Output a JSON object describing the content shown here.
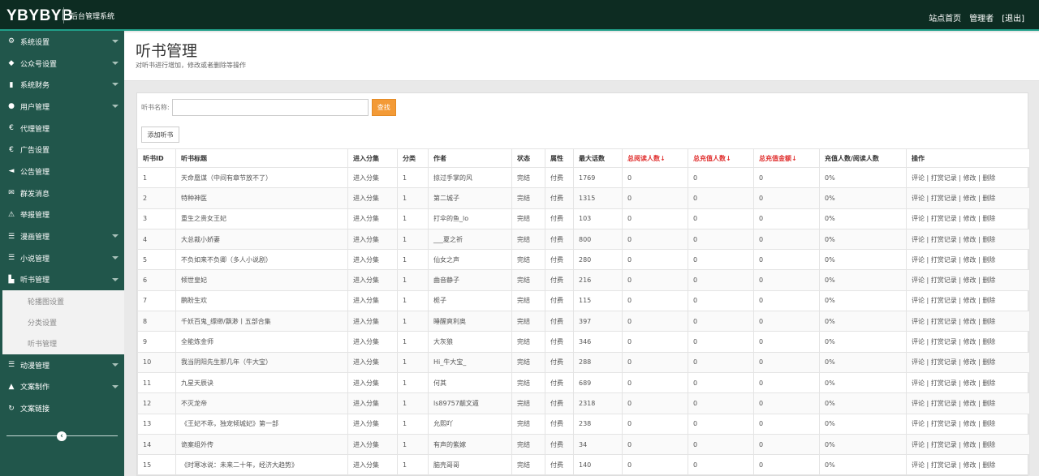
{
  "header": {
    "brand": "YBYBYB",
    "subtitle": "后台管理系统",
    "nav": [
      "站点首页",
      "管理者",
      "[退出]"
    ]
  },
  "sidebar": {
    "items": [
      {
        "icon": "⚙",
        "icon_name": "gear-icon",
        "label": "系统设置",
        "caret": true
      },
      {
        "icon": "◆",
        "icon_name": "tag-icon",
        "label": "公众号设置",
        "caret": true
      },
      {
        "icon": "▮",
        "icon_name": "bar-chart-icon",
        "label": "系统财务",
        "caret": true
      },
      {
        "icon": "●",
        "icon_name": "user-icon",
        "label": "用户管理",
        "caret": true
      },
      {
        "icon": "€",
        "icon_name": "euro-icon",
        "label": "代理管理",
        "caret": false
      },
      {
        "icon": "€",
        "icon_name": "euro-icon",
        "label": "广告设置",
        "caret": false
      },
      {
        "icon": "◄",
        "icon_name": "volume-icon",
        "label": "公告管理",
        "caret": false
      },
      {
        "icon": "✉",
        "icon_name": "envelope-icon",
        "label": "群发消息",
        "caret": false
      },
      {
        "icon": "⚠",
        "icon_name": "warning-icon",
        "label": "举报管理",
        "caret": false
      },
      {
        "icon": "☰",
        "icon_name": "list-icon",
        "label": "漫画管理",
        "caret": true
      },
      {
        "icon": "☰",
        "icon_name": "list-icon",
        "label": "小说管理",
        "caret": true
      },
      {
        "icon": "▙",
        "icon_name": "chart-icon",
        "label": "听书管理",
        "caret": true
      }
    ],
    "subitems": [
      "轮播图设置",
      "分类设置",
      "听书管理"
    ],
    "items_after": [
      {
        "icon": "☰",
        "icon_name": "list-icon",
        "label": "动漫管理",
        "caret": true
      },
      {
        "icon": "▲",
        "icon_name": "user-edit-icon",
        "label": "文案制作",
        "caret": true
      },
      {
        "icon": "↻",
        "icon_name": "link-icon",
        "label": "文案链接",
        "caret": false
      }
    ]
  },
  "page": {
    "title": "听书管理",
    "description": "对听书进行增加，修改或者删除等操作"
  },
  "search": {
    "label": "听书名称:",
    "placeholder": "",
    "button": "查找"
  },
  "add_button": "添加听书",
  "table": {
    "headers": [
      "听书ID",
      "听书标题",
      "进入分集",
      "分类",
      "作者",
      "状态",
      "属性",
      "最大话数",
      "总阅读人数↓",
      "总充值人数↓",
      "总充值金额↓",
      "充值人数/阅读人数",
      "操作"
    ],
    "red_headers": [
      8,
      9,
      10
    ],
    "ops": [
      "评论",
      "打赏记录",
      "修改",
      "删除"
    ],
    "rows": [
      [
        "1",
        "天命凰谋（中间有章节放不了）",
        "进入分集",
        "1",
        "掠过手掌的风",
        "完结",
        "付费",
        "1769",
        "0",
        "0",
        "0",
        "0%"
      ],
      [
        "2",
        "特种神医",
        "进入分集",
        "1",
        "第二城子",
        "完结",
        "付费",
        "1315",
        "0",
        "0",
        "0",
        "0%"
      ],
      [
        "3",
        "重生之贵女王妃",
        "进入分集",
        "1",
        "打伞的鱼_lo",
        "完结",
        "付费",
        "103",
        "0",
        "0",
        "0",
        "0%"
      ],
      [
        "4",
        "大总裁小娇妻",
        "进入分集",
        "1",
        "___夏之祈",
        "完结",
        "付费",
        "800",
        "0",
        "0",
        "0",
        "0%"
      ],
      [
        "5",
        "不负如来不负卿（多人小说剧）",
        "进入分集",
        "1",
        "仙女之声",
        "完结",
        "付费",
        "280",
        "0",
        "0",
        "0",
        "0%"
      ],
      [
        "6",
        "倾世皇妃",
        "进入分集",
        "1",
        "曲音静子",
        "完结",
        "付费",
        "216",
        "0",
        "0",
        "0",
        "0%"
      ],
      [
        "7",
        "鹏盼生欢",
        "进入分集",
        "1",
        "栀子",
        "完结",
        "付费",
        "115",
        "0",
        "0",
        "0",
        "0%"
      ],
      [
        "8",
        "千妖百鬼_缥缈/飘渺丨五部合集",
        "进入分集",
        "1",
        "睡醒爽利奥",
        "完结",
        "付费",
        "397",
        "0",
        "0",
        "0",
        "0%"
      ],
      [
        "9",
        "全能炼金师",
        "进入分集",
        "1",
        "大灰狼",
        "完结",
        "付费",
        "346",
        "0",
        "0",
        "0",
        "0%"
      ],
      [
        "10",
        "我当阴阳先生那几年（牛大宝）",
        "进入分集",
        "1",
        "Hi_牛大宝_",
        "完结",
        "付费",
        "288",
        "0",
        "0",
        "0",
        "0%"
      ],
      [
        "11",
        "九星天辰诀",
        "进入分集",
        "1",
        "何其",
        "完结",
        "付费",
        "689",
        "0",
        "0",
        "0",
        "0%"
      ],
      [
        "12",
        "不灭龙帝",
        "进入分集",
        "1",
        "ls89757靓文遁",
        "完结",
        "付费",
        "2318",
        "0",
        "0",
        "0",
        "0%"
      ],
      [
        "13",
        "《王妃不乖，独宠倾城妃》第一部",
        "进入分集",
        "1",
        "允熙吖",
        "完结",
        "付费",
        "238",
        "0",
        "0",
        "0",
        "0%"
      ],
      [
        "14",
        "诡案组外传",
        "进入分集",
        "1",
        "有声的紫嫁",
        "完结",
        "付费",
        "34",
        "0",
        "0",
        "0",
        "0%"
      ],
      [
        "15",
        "《时寒冰说：未来二十年，经济大趋势》",
        "进入分集",
        "1",
        "脑壳哥哥",
        "完结",
        "付费",
        "140",
        "0",
        "0",
        "0",
        "0%"
      ]
    ]
  }
}
